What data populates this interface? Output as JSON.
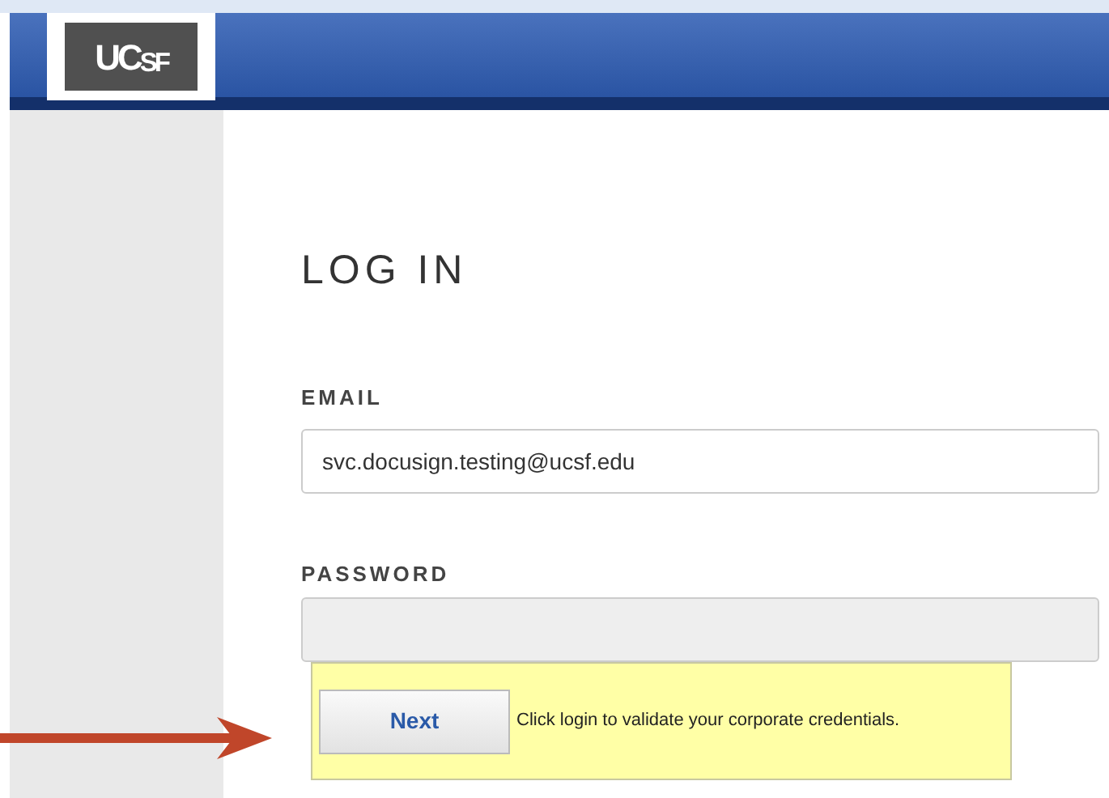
{
  "header": {
    "logo": "UC$_{SF}$"
  },
  "form": {
    "title": "LOG IN",
    "fields": [
      {
        "label": "EMAIL",
        "value": "svc.docusign.testing@ucsf.edu",
        "disabled": false
      },
      {
        "label": "PASSWORD",
        "disabled": true
      }
    ],
    "callout": {
      "button": "Next",
      "message": "Click login to validate your corporate credentials."
    }
  }
}
